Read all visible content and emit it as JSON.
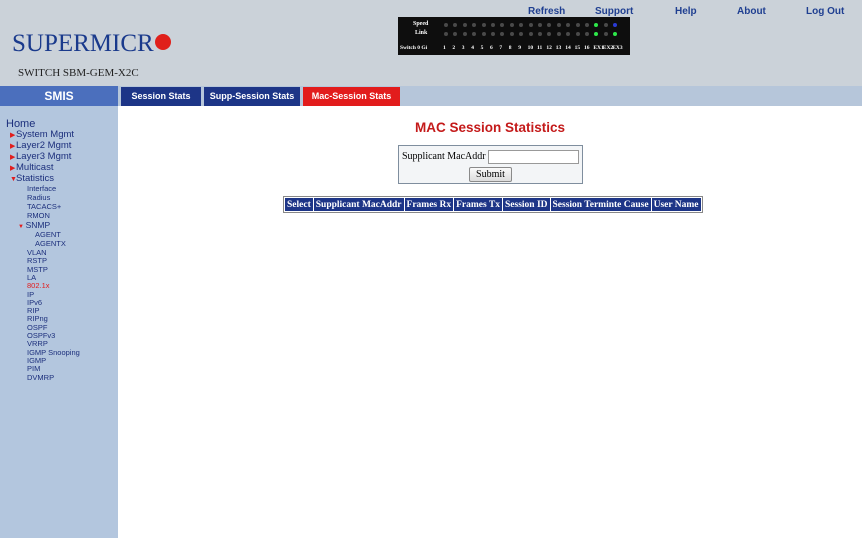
{
  "top_links": [
    "Refresh",
    "Support",
    "Help",
    "About",
    "Log Out"
  ],
  "brand": {
    "logo_text": "SUPERMICR",
    "switch_name": "SWITCH SBM-GEM-X2C"
  },
  "led_panel": {
    "row_labels": [
      "Speed",
      "Link"
    ],
    "port_label": "Switch 0 Gi",
    "port_numbers": [
      "1",
      "2",
      "3",
      "4",
      "5",
      "6",
      "7",
      "8",
      "9",
      "10",
      "11",
      "12",
      "13",
      "14",
      "15",
      "16",
      "EX1",
      "EX2",
      "EX3"
    ]
  },
  "tabbar": {
    "smis_label": "SMIS",
    "tabs": [
      {
        "label": "Session Stats",
        "active": false
      },
      {
        "label": "Supp-Session Stats",
        "active": false
      },
      {
        "label": "Mac-Session Stats",
        "active": true
      }
    ]
  },
  "sidebar": {
    "home": "Home",
    "items": [
      "System Mgmt",
      "Layer2 Mgmt",
      "Layer3 Mgmt",
      "Multicast",
      "Statistics"
    ],
    "stats_sub": [
      "Interface",
      "Radius",
      "TACACS+",
      "RMON"
    ],
    "snmp": "SNMP",
    "snmp_sub": [
      "AGENT",
      "AGENTX"
    ],
    "more_sub": [
      "VLAN",
      "RSTP",
      "MSTP",
      "LA",
      "802.1x",
      "IP",
      "IPv6",
      "RIP",
      "RIPng",
      "OSPF",
      "OSPFv3",
      "VRRP",
      "IGMP Snooping",
      "IGMP",
      "PIM",
      "DVMRP"
    ]
  },
  "main": {
    "title": "MAC Session Statistics",
    "form": {
      "label": "Supplicant MacAddr",
      "value": "",
      "submit": "Submit"
    },
    "table_headers": [
      "Select",
      "Supplicant MacAddr",
      "Frames Rx",
      "Frames Tx",
      "Session ID",
      "Session Terminte Cause",
      "User Name"
    ]
  },
  "colors": {
    "accent_red": "#e21c1c",
    "nav_blue": "#1d3587",
    "sidebar_bg": "#b3c6de"
  }
}
